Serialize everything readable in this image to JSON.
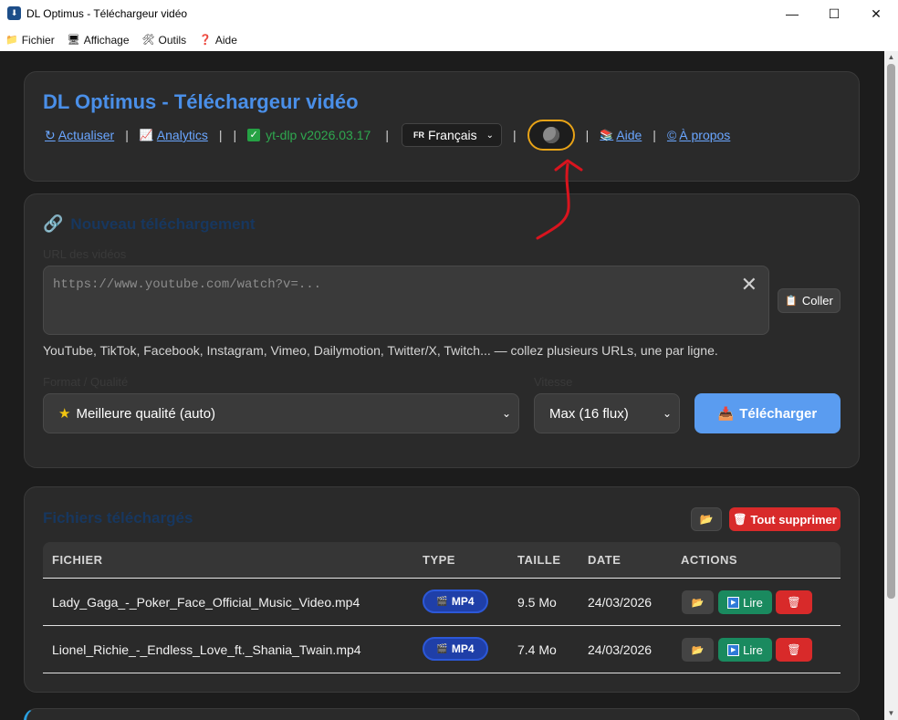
{
  "window": {
    "title": "DL Optimus - Téléchargeur vidéo",
    "minimize": "—",
    "maximize": "☐",
    "close": "✕"
  },
  "menubar": [
    {
      "icon": "folder-icon",
      "glyph": "📁",
      "label": "Fichier"
    },
    {
      "icon": "monitor-icon",
      "glyph": "🖥",
      "label": "Affichage"
    },
    {
      "icon": "tools-icon",
      "glyph": "🛠",
      "label": "Outils"
    },
    {
      "icon": "help-icon",
      "glyph": "❓",
      "label": "Aide"
    }
  ],
  "header": {
    "title": "DL Optimus - Téléchargeur vidéo",
    "refresh_label": "Actualiser",
    "analytics_label": "Analytics",
    "ytdlp_label": "yt-dlp v2026.03.17",
    "language_flag": "FR",
    "language_label": "Français",
    "help_label": "Aide",
    "about_label": "À propos",
    "separator": "|"
  },
  "new_download": {
    "title": "Nouveau téléchargement",
    "url_label": "URL des vidéos",
    "url_placeholder": "https://www.youtube.com/watch?v=...",
    "paste_label": "Coller",
    "hint": "YouTube, TikTok, Facebook, Instagram, Vimeo, Dailymotion, Twitter/X, Twitch... — collez plusieurs URLs, une par ligne.",
    "format_label": "Format / Qualité",
    "format_value": "Meilleure qualité (auto)",
    "speed_label": "Vitesse",
    "speed_value": "Max (16 flux)",
    "download_label": "Télécharger"
  },
  "files": {
    "title": "Fichiers téléchargés",
    "delete_all_label": "Tout supprimer",
    "columns": [
      "FICHIER",
      "TYPE",
      "TAILLE",
      "DATE",
      "ACTIONS"
    ],
    "rows": [
      {
        "name": "Lady_Gaga_-_Poker_Face_Official_Music_Video.mp4",
        "type": "MP4",
        "size": "9.5 Mo",
        "date": "24/03/2026"
      },
      {
        "name": "Lionel_Richie_-_Endless_Love_ft._Shania_Twain.mp4",
        "type": "MP4",
        "size": "7.4 Mo",
        "date": "24/03/2026"
      }
    ],
    "play_label": "Lire"
  },
  "colors": {
    "accent": "#4a8fe8",
    "link": "#6aa6ff",
    "success": "#2fa84f",
    "danger": "#d82a2a",
    "annotation": "#d9141e"
  }
}
